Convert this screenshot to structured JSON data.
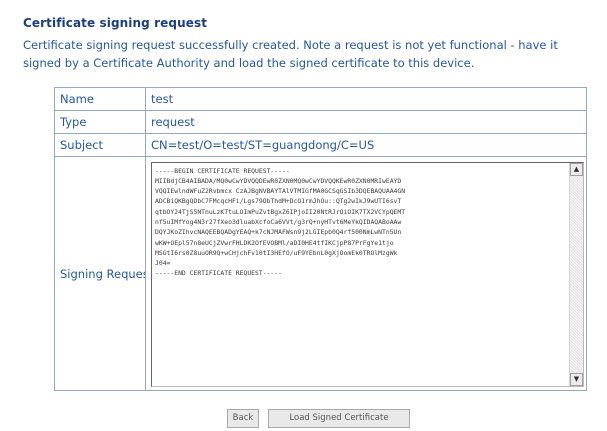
{
  "page": {
    "heading": "Certificate signing request",
    "description": "Certificate signing request successfully created. Note a request is not yet functional - have it signed by a Certificate Authority and load the signed certificate to this device."
  },
  "fields": {
    "name": {
      "label": "Name",
      "value": "test"
    },
    "type": {
      "label": "Type",
      "value": "request"
    },
    "subject": {
      "label": "Subject",
      "value": "CN=test/O=test/ST=guangdong/C=US"
    },
    "signing_request": {
      "label": "Signing Request",
      "value": "-----BEGIN CERTIFICATE REQUEST-----\nMIIBdjCB4AIBADA/MQ0wCwYDVQQDEwR0ZXN0MQ0wCwYDVQQKEwR0ZXN0MRIwEAYD\nVQQIEwlndWFuZ2Rvbmcx CzAJBgNVBAYTAlVTMIGfMA0GCSqGSIb3DQEBAQUAA4GN\nADCBiQKBgQDbC7FMcqcHFi/Lgs79ObThdM+DcO1rmJhOu::QTg2wIkJ9wUTI6svT\nqtbOY24TjS5NTnuLzKTtuLOImPuZvtBgxZ6IPjoII20NtRJrOiOIK7TX2VCYpQEMT\nnf5uIMfYog4N3r27fXeo3dluabXcfoCa6VVt/g3rQ+nyHTvt6MeYkQIDAQABoAAw\nDQYJKoZIhvcNAQEEBQADgYEAQ+k7cNJMAFWsn9j2LGIEpb0Q4rf500NmLwNTn5Un\nwKW+OEpl57n8eUCjZVwrFHLDK2OfEVOBMl/aDI0HE4tfIKCjpP87PrFgYe1tjo\nMSGtI6rs0Z8uuOR9Q+wCHjchFv10tI3HEfO/uF9YEbnL0gXjOomEk0TROlMzgWk\nJ04=\n-----END CERTIFICATE REQUEST-----"
    }
  },
  "buttons": {
    "back": "Back",
    "load": "Load Signed Certificate"
  },
  "icons": {
    "scroll_up": "scroll-up-arrow-icon",
    "scroll_down": "scroll-down-arrow-icon"
  }
}
